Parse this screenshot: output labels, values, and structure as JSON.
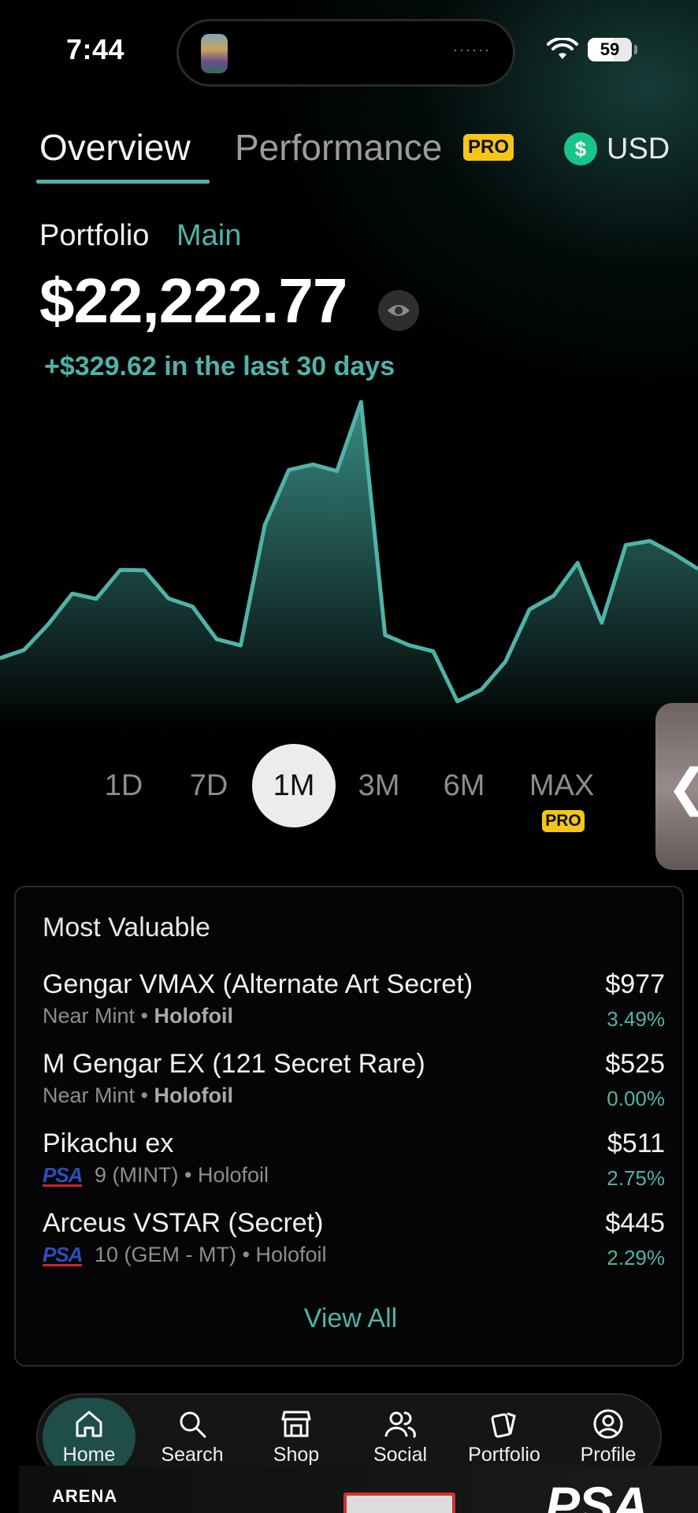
{
  "status_bar": {
    "time": "7:44",
    "battery": "59",
    "battery_level": 0.59
  },
  "tabs": {
    "overview": "Overview",
    "performance": "Performance",
    "pro_badge": "PRO",
    "currency_symbol": "$",
    "currency": "USD"
  },
  "portfolio": {
    "label": "Portfolio",
    "name": "Main",
    "value": "$22,222.77",
    "change": "+$329.62 in the last 30 days"
  },
  "chart_data": {
    "type": "area",
    "title": "",
    "xlabel": "",
    "ylabel": "",
    "color": "#4fb3a9",
    "x": [
      1,
      2,
      3,
      4,
      5,
      6,
      7,
      8,
      9,
      10,
      11,
      12,
      13,
      14,
      15,
      16,
      17,
      18,
      19,
      20,
      21,
      22,
      23,
      24,
      25,
      26,
      27,
      28,
      29,
      30
    ],
    "values": [
      22006.5,
      22026.6,
      22088.3,
      22162.9,
      22150.3,
      22220.4,
      22219.4,
      22151.1,
      22131.4,
      22052.6,
      22037.3,
      22328.7,
      22462.4,
      22475.8,
      22459.6,
      22627.3,
      22062.6,
      22037.9,
      22023.3,
      21901.9,
      21930.3,
      21998.1,
      22124.7,
      22157.6,
      22237.3,
      22092.2,
      22280.5,
      22290.3,
      22259.4,
      22222.8
    ]
  },
  "ranges": {
    "items": [
      "1D",
      "7D",
      "1M",
      "3M",
      "6M",
      "MAX"
    ],
    "active": "1M",
    "pro_badge": "PRO"
  },
  "side_handle": {
    "icon": "chevron-left-icon",
    "glyph": "❮"
  },
  "most_valuable": {
    "title": "Most Valuable",
    "items": [
      {
        "name": "Gengar VMAX (Alternate Art Secret)",
        "condition": "Near Mint",
        "finish": "Holofoil",
        "price": "$977",
        "change": "3.49%"
      },
      {
        "name": "M Gengar EX (121 Secret Rare)",
        "condition": "Near Mint",
        "finish": "Holofoil",
        "price": "$525",
        "change": "0.00%"
      },
      {
        "name": "Pikachu ex",
        "grader": "PSA",
        "grade": "9 (MINT)",
        "finish": "Holofoil",
        "price": "$511",
        "change": "2.75%"
      },
      {
        "name": "Arceus VSTAR (Secret)",
        "grader": "PSA",
        "grade": "10 (GEM - MT)",
        "finish": "Holofoil",
        "price": "$445",
        "change": "2.29%"
      }
    ],
    "separator": "•",
    "view_all": "View All"
  },
  "nav": {
    "items": [
      {
        "label": "Home",
        "icon": "home-icon"
      },
      {
        "label": "Search",
        "icon": "search-icon"
      },
      {
        "label": "Shop",
        "icon": "shop-icon"
      },
      {
        "label": "Social",
        "icon": "users-icon"
      },
      {
        "label": "Portfolio",
        "icon": "cards-icon"
      },
      {
        "label": "Profile",
        "icon": "profile-icon"
      }
    ],
    "active": "Home"
  },
  "ad": {
    "brand_left": "ARENA",
    "brand_right": "PSA"
  },
  "colors": {
    "accent": "#4fb3a9",
    "pro": "#f5c518",
    "usd": "#19c38a",
    "background": "#000000"
  }
}
